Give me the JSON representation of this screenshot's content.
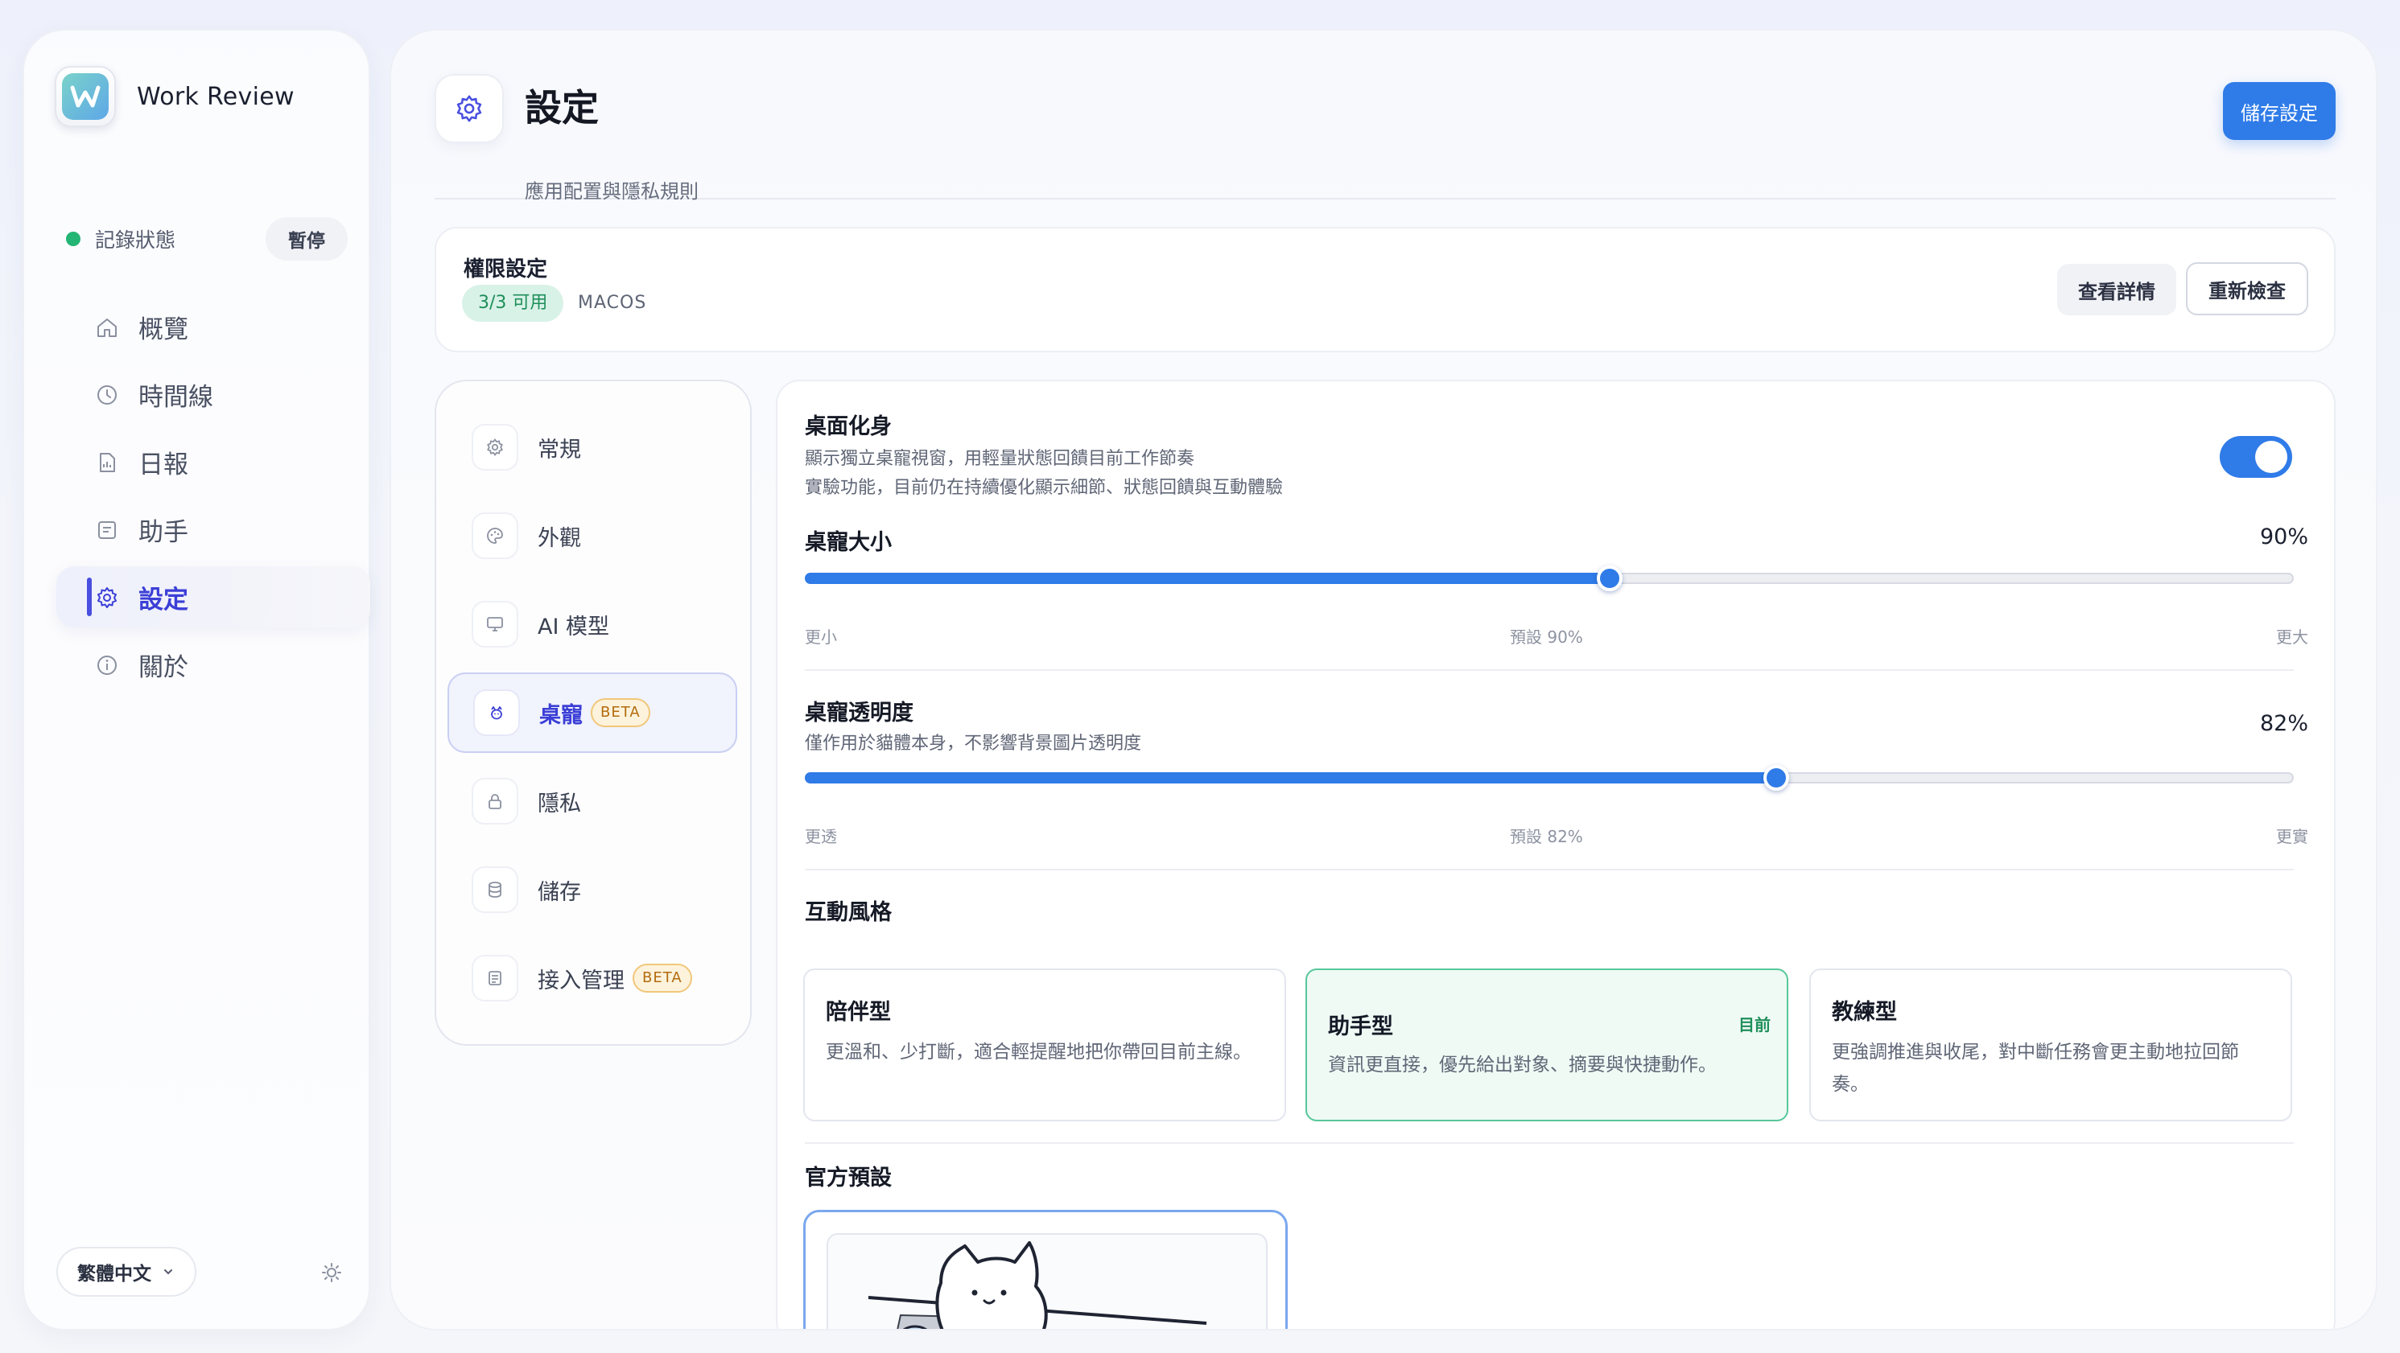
{
  "app": {
    "name": "Work Review"
  },
  "status": {
    "label": "記錄狀態",
    "pause_label": "暫停",
    "color": "#22b573"
  },
  "nav": {
    "items": [
      {
        "label": "概覽",
        "icon": "home-icon"
      },
      {
        "label": "時間線",
        "icon": "clock-icon"
      },
      {
        "label": "日報",
        "icon": "report-icon"
      },
      {
        "label": "助手",
        "icon": "assistant-icon"
      },
      {
        "label": "設定",
        "icon": "gear-icon",
        "active": true
      },
      {
        "label": "關於",
        "icon": "info-icon"
      }
    ]
  },
  "footer": {
    "language": "繁體中文",
    "theme_icon": "sun-icon"
  },
  "header": {
    "title": "設定",
    "subtitle": "應用配置與隱私規則",
    "save_label": "儲存設定"
  },
  "permissions": {
    "title": "權限設定",
    "badge": "3/3 可用",
    "os": "MACOS",
    "detail_label": "查看詳情",
    "recheck_label": "重新檢查"
  },
  "subnav": {
    "items": [
      {
        "label": "常規",
        "icon": "gear-icon"
      },
      {
        "label": "外觀",
        "icon": "palette-icon"
      },
      {
        "label": "AI 模型",
        "icon": "monitor-icon"
      },
      {
        "label": "桌寵",
        "icon": "pet-icon",
        "badge": "BETA",
        "active": true
      },
      {
        "label": "隱私",
        "icon": "lock-icon"
      },
      {
        "label": "儲存",
        "icon": "database-icon"
      },
      {
        "label": "接入管理",
        "icon": "list-icon",
        "badge": "BETA"
      }
    ]
  },
  "pet": {
    "avatar": {
      "title": "桌面化身",
      "desc1": "顯示獨立桌寵視窗，用輕量狀態回饋目前工作節奏",
      "desc2": "實驗功能，目前仍在持續優化顯示細節、狀態回饋與互動體驗",
      "enabled": true
    },
    "size": {
      "title": "桌寵大小",
      "value_label": "90%",
      "value": 90,
      "min_label": "更小",
      "default_label": "預設 90%",
      "max_label": "更大"
    },
    "opacity": {
      "title": "桌寵透明度",
      "desc": "僅作用於貓體本身，不影響背景圖片透明度",
      "value_label": "82%",
      "value": 82,
      "min_label": "更透",
      "default_label": "預設 82%",
      "max_label": "更實"
    },
    "interaction": {
      "title": "互動風格",
      "current_label": "目前",
      "styles": [
        {
          "name": "陪伴型",
          "desc": "更溫和、少打斷，適合輕提醒地把你帶回目前主線。"
        },
        {
          "name": "助手型",
          "desc": "資訊更直接，優先給出對象、摘要與快捷動作。",
          "active": true
        },
        {
          "name": "教練型",
          "desc": "更強調推進與收尾，對中斷任務會更主動地拉回節奏。"
        }
      ]
    },
    "preset": {
      "title": "官方預設"
    }
  },
  "colors": {
    "accent": "#2f7be8",
    "nav_active": "#3b3fd6",
    "success": "#1f8f5a"
  }
}
